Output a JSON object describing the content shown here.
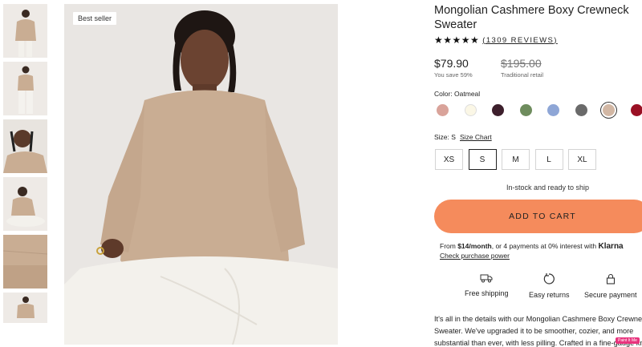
{
  "badge": "Best seller",
  "product": {
    "title": "Mongolian Cashmere Boxy Crewneck Sweater",
    "stars": "★★★★★",
    "reviews": "(1309 REVIEWS)",
    "price": "$79.90",
    "savings": "You save 59%",
    "original_price": "$195.00",
    "original_label": "Traditional retail",
    "color_label": "Color: Oatmeal",
    "swatches": [
      "#d9a39a",
      "#fbf7e6",
      "#3d1f2c",
      "#6e8c5d",
      "#8ea6d6",
      "#6a6a6a",
      "#d2b7a4",
      "#9a1024",
      "#0a0a0a"
    ],
    "size_label": "Size: S",
    "size_chart": "Size Chart",
    "sizes": [
      "XS",
      "S",
      "M",
      "L",
      "XL"
    ],
    "stock": "In-stock and ready to ship",
    "cart_button": "ADD TO CART",
    "klarna_prefix": "From ",
    "klarna_amount": "$14/month",
    "klarna_suffix": ", or 4 payments at 0% interest with ",
    "klarna_brand": "Klarna",
    "check_power": "Check purchase power",
    "features": [
      "Free shipping",
      "Easy returns",
      "Secure payment"
    ],
    "description_lines": [
      "It's all in the details with our Mongolian Cashmere Boxy Crewneck",
      "Sweater. We've upgraded it to be smoother, cozier, and more",
      "substantial than ever, with less pilling. Crafted in a fine-gauge knit"
    ]
  },
  "extension_tag": "Paint It Me",
  "colors": {
    "accent": "#f58b5c",
    "sweater": "#c9ad93"
  }
}
